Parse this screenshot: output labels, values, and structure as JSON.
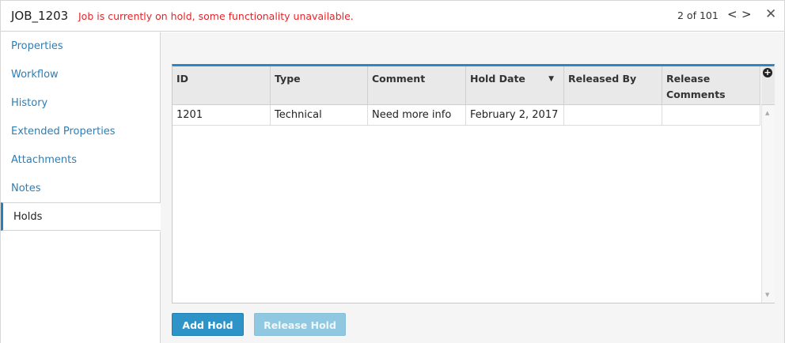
{
  "header": {
    "job_id": "JOB_1203",
    "hold_message": "Job is currently on hold, some functionality unavailable.",
    "pager_text": "2 of 101",
    "prev_icon": "<",
    "next_icon": ">",
    "close_icon": "✕"
  },
  "sidebar": {
    "items": [
      {
        "label": "Properties"
      },
      {
        "label": "Workflow"
      },
      {
        "label": "History"
      },
      {
        "label": "Extended Properties"
      },
      {
        "label": "Attachments"
      },
      {
        "label": "Notes"
      },
      {
        "label": "Holds",
        "active": true
      }
    ]
  },
  "grid": {
    "columns": [
      "ID",
      "Type",
      "Comment",
      "Hold Date",
      "Released By",
      "Release Comments"
    ],
    "sorted_column": "Hold Date",
    "rows": [
      [
        "1201",
        "Technical",
        "Need more info",
        "February 2, 2017",
        "",
        ""
      ]
    ],
    "add_icon": "plus-circle-icon"
  },
  "buttons": {
    "add_hold": "Add Hold",
    "release_hold": "Release Hold"
  },
  "colors": {
    "accent": "#2a88c8",
    "link": "#2a7fb8",
    "warning": "#e0262a",
    "button_primary": "#2e93c7",
    "button_disabled": "#8fc8e0"
  }
}
